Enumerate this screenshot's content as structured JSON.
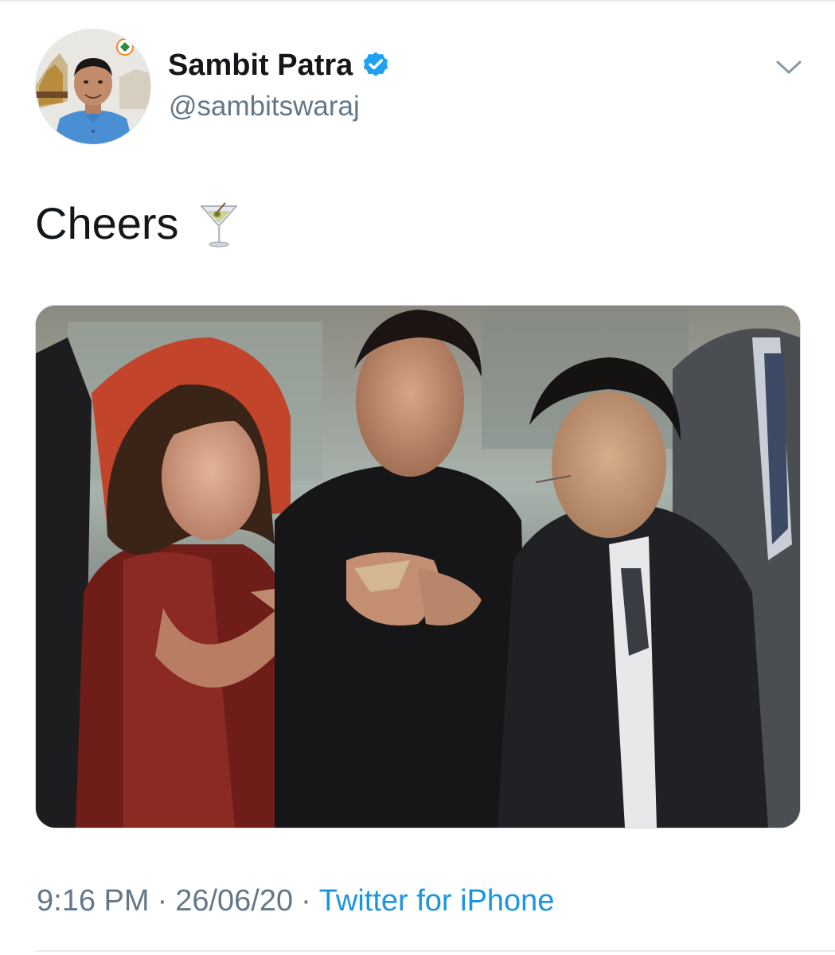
{
  "tweet": {
    "author": {
      "display_name": "Sambit Patra",
      "handle": "@sambitswaraj",
      "verified": true,
      "avatar_icon": "profile-photo"
    },
    "menu_icon": "chevron-down-icon",
    "text": "Cheers",
    "emoji_icon": "cocktail-glass-icon",
    "media": {
      "type": "photo",
      "alt_icon": "photo-of-people-toasting"
    },
    "meta": {
      "time": "9:16 PM",
      "separator": "·",
      "date": "26/06/20",
      "source": "Twitter for iPhone"
    }
  },
  "colors": {
    "text_primary": "#14171a",
    "text_secondary": "#657786",
    "link": "#1b95e0",
    "verified": "#1da1f2",
    "divider": "#e6ecf0"
  }
}
